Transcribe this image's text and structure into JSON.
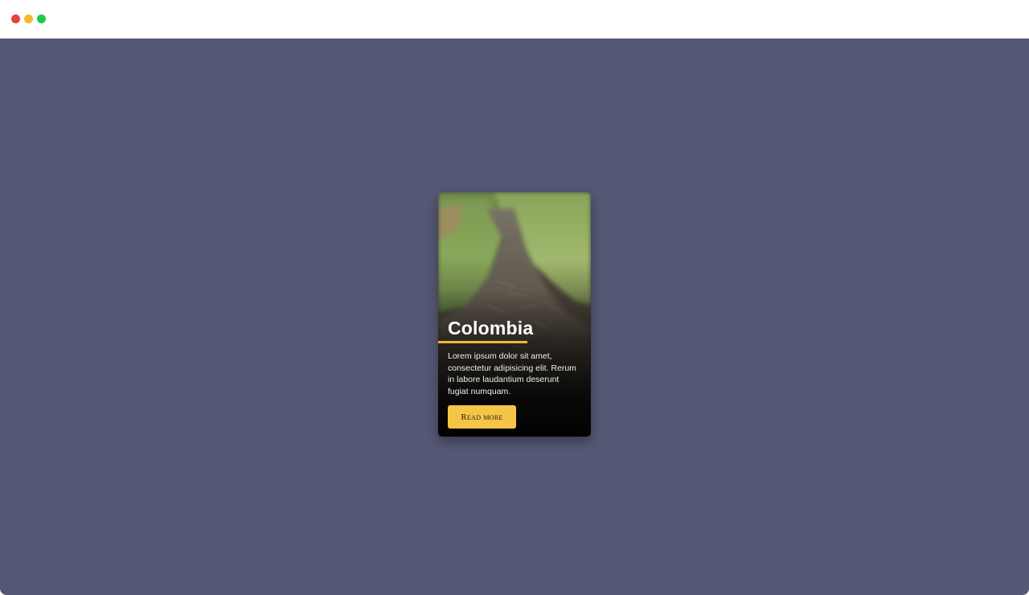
{
  "window": {
    "controls": [
      "close",
      "minimize",
      "maximize"
    ]
  },
  "colors": {
    "page_background": "#555874",
    "accent": "#f2b531",
    "button": "#f6c546"
  },
  "card": {
    "image": "forest-path-photo",
    "title": "Colombia",
    "description": "Lorem ipsum dolor sit amet, consectetur adipisicing elit. Rerum in labore laudantium deserunt fugiat numquam.",
    "button_label": "Read more"
  }
}
